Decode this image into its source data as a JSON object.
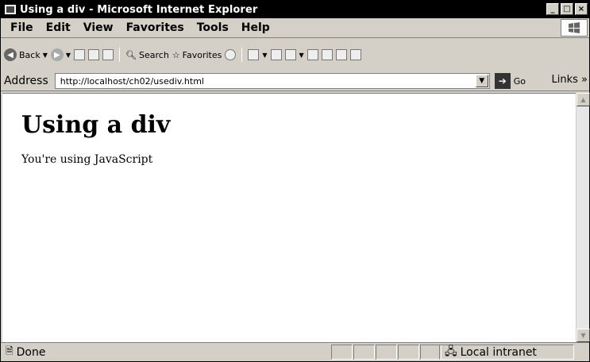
{
  "window": {
    "title": "Using a div - Microsoft Internet Explorer"
  },
  "menu": [
    "File",
    "Edit",
    "View",
    "Favorites",
    "Tools",
    "Help"
  ],
  "toolbar": {
    "back_label": "Back",
    "search_label": "Search",
    "favorites_label": "Favorites"
  },
  "address": {
    "label": "Address",
    "url": "http://localhost/ch02/usediv.html",
    "go_label": "Go",
    "links_label": "Links »"
  },
  "page": {
    "heading": "Using a div",
    "text": "You're using JavaScript"
  },
  "status": {
    "text": "Done",
    "zone": "Local intranet"
  }
}
